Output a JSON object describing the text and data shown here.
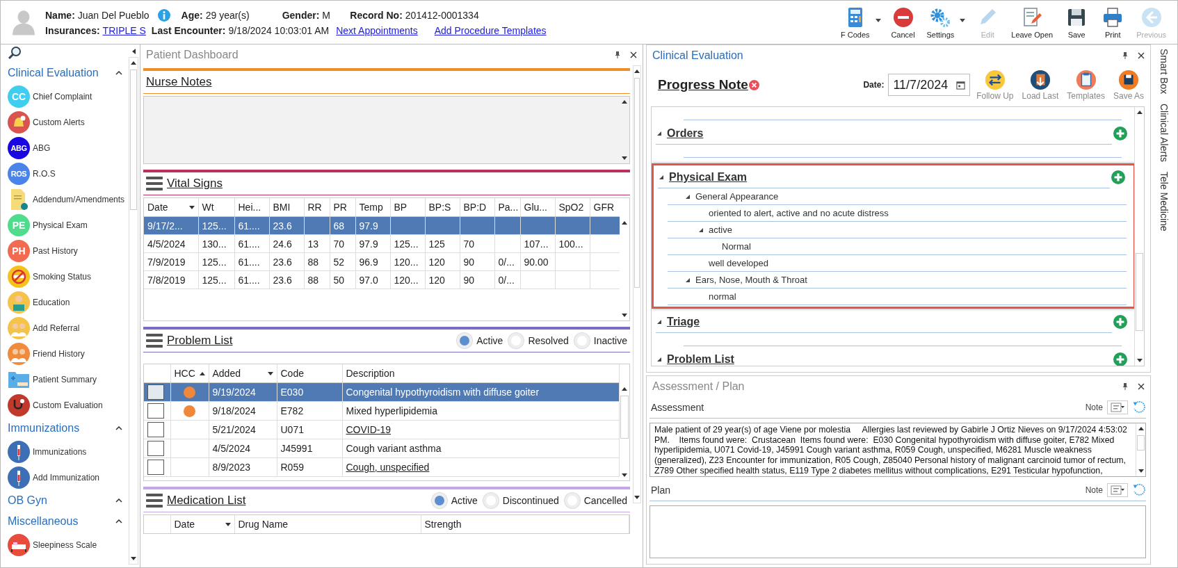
{
  "patient": {
    "name_label": "Name:",
    "name": "Juan Del Pueblo",
    "age_label": "Age:",
    "age": "29 year(s)",
    "gender_label": "Gender:",
    "gender": "M",
    "record_label": "Record No:",
    "record": "201412-0001334",
    "insurances_label": "Insurances:",
    "insurance": "TRIPLE S",
    "last_encounter_label": "Last Encounter:",
    "last_encounter": "9/18/2024 10:03:01 AM",
    "links": [
      "Next Appointments",
      "Add Procedure Templates"
    ]
  },
  "toolbar": [
    {
      "label": "F Codes",
      "kind": "fcodes",
      "dropdown": true,
      "disabled": false
    },
    {
      "label": "Cancel",
      "kind": "cancel",
      "dropdown": false,
      "disabled": false
    },
    {
      "label": "Settings",
      "kind": "settings",
      "dropdown": true,
      "disabled": false
    },
    {
      "label": "Edit",
      "kind": "edit",
      "dropdown": false,
      "disabled": true
    },
    {
      "label": "Leave Open",
      "kind": "leaveopen",
      "dropdown": false,
      "disabled": false
    },
    {
      "label": "Save",
      "kind": "save",
      "dropdown": false,
      "disabled": false
    },
    {
      "label": "Print",
      "kind": "print",
      "dropdown": false,
      "disabled": false
    },
    {
      "label": "Previous",
      "kind": "previous",
      "dropdown": false,
      "disabled": true
    }
  ],
  "sidebar": {
    "sections": [
      {
        "title": "Clinical Evaluation",
        "items": [
          {
            "label": "Chief Complaint",
            "kind": "letters",
            "letters": "CC",
            "color": "#3fcdf0"
          },
          {
            "label": "Custom Alerts",
            "kind": "bell",
            "color": "#d9534f"
          },
          {
            "label": "ABG",
            "kind": "letters",
            "letters": "ABG",
            "color": "#1a06e0"
          },
          {
            "label": "R.O.S",
            "kind": "letters",
            "letters": "ROS",
            "color": "#4a84e8"
          },
          {
            "label": "Addendum/Amendments",
            "kind": "document",
            "color": "#f5dc78"
          },
          {
            "label": "Physical Exam",
            "kind": "letters",
            "letters": "PE",
            "color": "#4fdc8c"
          },
          {
            "label": "Past History",
            "kind": "letters",
            "letters": "PH",
            "color": "#f26a50"
          },
          {
            "label": "Smoking Status",
            "kind": "nosmoke",
            "color": "#f5c21b"
          },
          {
            "label": "Education",
            "kind": "person",
            "color": "#f5c34a"
          },
          {
            "label": "Add Referral",
            "kind": "people",
            "color": "#f5c34a"
          },
          {
            "label": "Friend History",
            "kind": "people",
            "color": "#f08a3c"
          },
          {
            "label": "Patient Summary",
            "kind": "folder",
            "color": "#5aaee8"
          },
          {
            "label": "Custom Evaluation",
            "kind": "stethoscope",
            "color": "#c0392b"
          }
        ]
      },
      {
        "title": "Immunizations",
        "items": [
          {
            "label": "Immunizations",
            "kind": "syringe",
            "color": "#3d6fb6"
          },
          {
            "label": "Add Immunization",
            "kind": "syringe",
            "color": "#3d6fb6"
          }
        ]
      },
      {
        "title": "OB Gyn"
      },
      {
        "title": "Miscellaneous",
        "items": [
          {
            "label": "Sleepiness Scale",
            "kind": "bed",
            "color": "#e74c3c"
          }
        ]
      }
    ]
  },
  "dashboard": {
    "title": "Patient Dashboard",
    "nurse_notes": {
      "title": "Nurse Notes"
    },
    "vital_signs": {
      "title": "Vital Signs",
      "columns": [
        {
          "label": "Date",
          "sort_ascending": false
        },
        {
          "label": "Wt"
        },
        {
          "label": "Hei..."
        },
        {
          "label": "BMI"
        },
        {
          "label": "RR"
        },
        {
          "label": "PR"
        },
        {
          "label": "Temp"
        },
        {
          "label": "BP"
        },
        {
          "label": "BP:S"
        },
        {
          "label": "BP:D"
        },
        {
          "label": "Pa..."
        },
        {
          "label": "Glu..."
        },
        {
          "label": "SpO2"
        },
        {
          "label": "GFR"
        }
      ],
      "rows": [
        {
          "selected": true,
          "cells": [
            "9/17/2...",
            "125...",
            "61....",
            "23.6",
            null,
            "68",
            "97.9",
            null,
            null,
            null,
            null,
            null,
            null,
            null
          ]
        },
        {
          "selected": false,
          "cells": [
            "4/5/2024",
            "130...",
            "61....",
            "24.6",
            "13",
            "70",
            "97.9",
            "125...",
            "125",
            "70",
            null,
            "107...",
            "100...",
            null
          ]
        },
        {
          "selected": false,
          "cells": [
            "7/9/2019",
            "125...",
            "61....",
            "23.6",
            "88",
            "52",
            "96.9",
            "120...",
            "120",
            "90",
            "0/...",
            "90.00",
            null,
            null
          ]
        },
        {
          "selected": false,
          "cells": [
            "7/8/2019",
            "125...",
            "61....",
            "23.6",
            "88",
            "50",
            "97.0",
            "120...",
            "120",
            "90",
            "0/...",
            null,
            null,
            null
          ]
        }
      ]
    },
    "problem_list": {
      "title": "Problem List",
      "filters": [
        {
          "label": "Active",
          "selected": true
        },
        {
          "label": "Resolved",
          "selected": false
        },
        {
          "label": "Inactive",
          "selected": false
        }
      ],
      "columns": [
        {
          "label": "HCC",
          "sort_ascending": true
        },
        {
          "label": "Added",
          "sort_ascending": false
        },
        {
          "label": "Code"
        },
        {
          "label": "Description"
        }
      ],
      "rows": [
        {
          "selected": true,
          "hcc": true,
          "added": "9/19/2024",
          "code": "E030",
          "description": "Congenital hypothyroidism with diffuse goiter",
          "linked": false
        },
        {
          "selected": false,
          "hcc": true,
          "added": "9/18/2024",
          "code": "E782",
          "description": "Mixed hyperlipidemia",
          "linked": false
        },
        {
          "selected": false,
          "hcc": false,
          "added": "5/21/2024",
          "code": "U071",
          "description": "COVID-19",
          "linked": true
        },
        {
          "selected": false,
          "hcc": false,
          "added": "4/5/2024",
          "code": "J45991",
          "description": "Cough variant asthma",
          "linked": false
        },
        {
          "selected": false,
          "hcc": false,
          "added": "8/9/2023",
          "code": "R059",
          "description": "Cough, unspecified",
          "linked": true
        }
      ]
    },
    "medication_list": {
      "title": "Medication List",
      "filters": [
        {
          "label": "Active",
          "selected": true
        },
        {
          "label": "Discontinued",
          "selected": false
        },
        {
          "label": "Cancelled",
          "selected": false
        }
      ],
      "columns": [
        {
          "label": "Date",
          "sort_ascending": false
        },
        {
          "label": "Drug Name"
        },
        {
          "label": "Strength"
        }
      ]
    }
  },
  "clinical_evaluation": {
    "title": "Clinical Evaluation",
    "note_title": "Progress Note",
    "date_label": "Date:",
    "date": "11/7/2024",
    "actions": [
      {
        "label": "Follow Up",
        "kind": "followup"
      },
      {
        "label": "Load Last",
        "kind": "loadlast"
      },
      {
        "label": "Templates",
        "kind": "templates"
      },
      {
        "label": "Save As",
        "kind": "saveas"
      }
    ],
    "sections": [
      {
        "title": "Orders",
        "highlighted": false
      },
      {
        "title": "Physical Exam",
        "highlighted": true,
        "children": [
          {
            "label": "General Appearance",
            "children": [
              {
                "label": "oriented to alert, active and no acute distress"
              },
              {
                "label": "active",
                "children": [
                  {
                    "label": "Normal"
                  }
                ]
              },
              {
                "label": "well developed"
              }
            ]
          },
          {
            "label": "Ears, Nose, Mouth & Throat",
            "children": [
              {
                "label": "normal"
              }
            ]
          }
        ]
      },
      {
        "title": "Triage",
        "highlighted": false
      },
      {
        "title": "Problem List",
        "highlighted": false
      }
    ]
  },
  "assessment_plan": {
    "title": "Assessment / Plan",
    "fields": [
      {
        "label": "Assessment",
        "note_label": "Note",
        "value": "Male patient of 29 year(s) of age Viene por molestia     Allergies last reviewed by Gabirle J Ortiz Nieves on 9/17/2024 4:53:02 PM.    Items found were:  Crustacean  Items found were:  E030 Congenital hypothyroidism with diffuse goiter, E782 Mixed hyperlipidemia, U071 Covid-19, J45991 Cough variant asthma, R059 Cough, unspecified, M6281 Muscle weakness (generalized), Z23 Encounter for immunization, R05 Cough, Z85040 Personal history of malignant carcinoid tumor of rectum, Z789 Other specified health status, E119 Type 2 diabetes mellitus without complications, E291 Testicular hypofunction,"
      },
      {
        "label": "Plan",
        "note_label": "Note"
      }
    ]
  },
  "side_tabs": [
    "Smart Box",
    "Clinical Alerts",
    "Tele Medicine"
  ]
}
